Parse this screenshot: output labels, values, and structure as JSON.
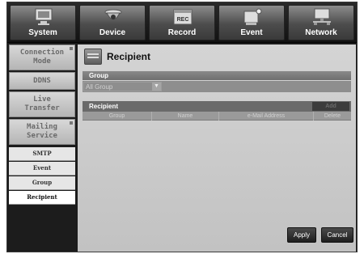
{
  "nav": {
    "tabs": [
      {
        "label": "System",
        "icon": "monitor-icon"
      },
      {
        "label": "Device",
        "icon": "camera-icon"
      },
      {
        "label": "Record",
        "icon": "record-icon"
      },
      {
        "label": "Event",
        "icon": "event-icon"
      },
      {
        "label": "Network",
        "icon": "network-icon"
      }
    ]
  },
  "sidebar": {
    "items": [
      {
        "label": "Connection Mode"
      },
      {
        "label": "DDNS"
      },
      {
        "label": "Live Transfer"
      },
      {
        "label": "Mailing Service"
      }
    ],
    "subitems": [
      {
        "label": "SMTP"
      },
      {
        "label": "Event"
      },
      {
        "label": "Group"
      },
      {
        "label": "Recipient"
      }
    ]
  },
  "page": {
    "title": "Recipient",
    "group_header": "Group",
    "group_select": "All Group",
    "recipient_header": "Recipient",
    "add_label": "Add",
    "columns": [
      "Group",
      "Name",
      "e-Mail Address",
      "Delete"
    ],
    "apply_label": "Apply",
    "cancel_label": "Cancel"
  },
  "colors": {
    "frame": "#1b1b1b",
    "content": "#c8c8c8",
    "header": "#6a6a6a"
  }
}
